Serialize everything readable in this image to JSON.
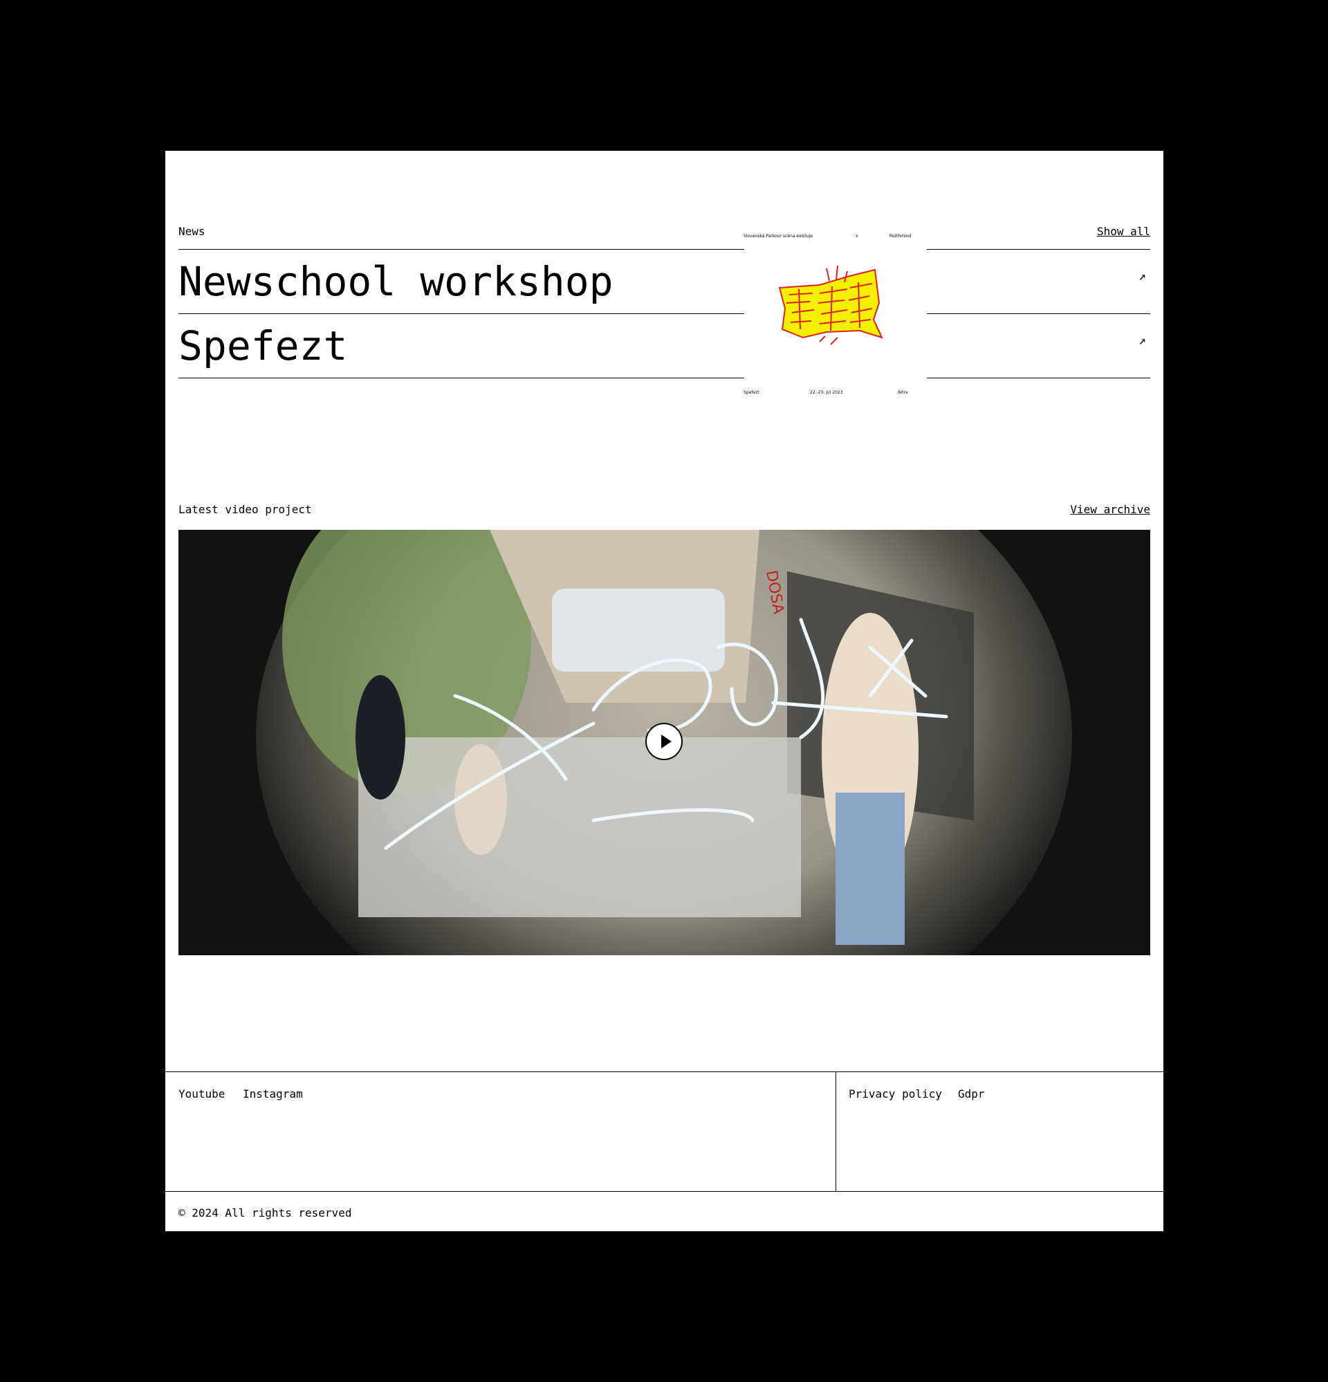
{
  "news": {
    "label": "News",
    "show_all": "Show all",
    "items": [
      {
        "title": "Newschool workshop",
        "arrow": "↗"
      },
      {
        "title": "Spefezt",
        "arrow": "↗"
      }
    ],
    "poster": {
      "top_left": "Slovenská Parkour scéna existuje",
      "top_mid": "x",
      "top_right": "Fezthmind",
      "bottom_left": "Spefezt",
      "bottom_mid": "22.-23. Júl 2023",
      "bottom_right": "Nitra",
      "colors": {
        "fill": "#f5f000",
        "stroke": "#e02020"
      }
    }
  },
  "video": {
    "label": "Latest video project",
    "view_archive": "View archive",
    "play_icon": "play-icon"
  },
  "footer": {
    "left_links": [
      "Youtube",
      "Instagram"
    ],
    "right_links": [
      "Privacy policy",
      "Gdpr"
    ],
    "copyright": "© 2024 All rights reserved"
  }
}
